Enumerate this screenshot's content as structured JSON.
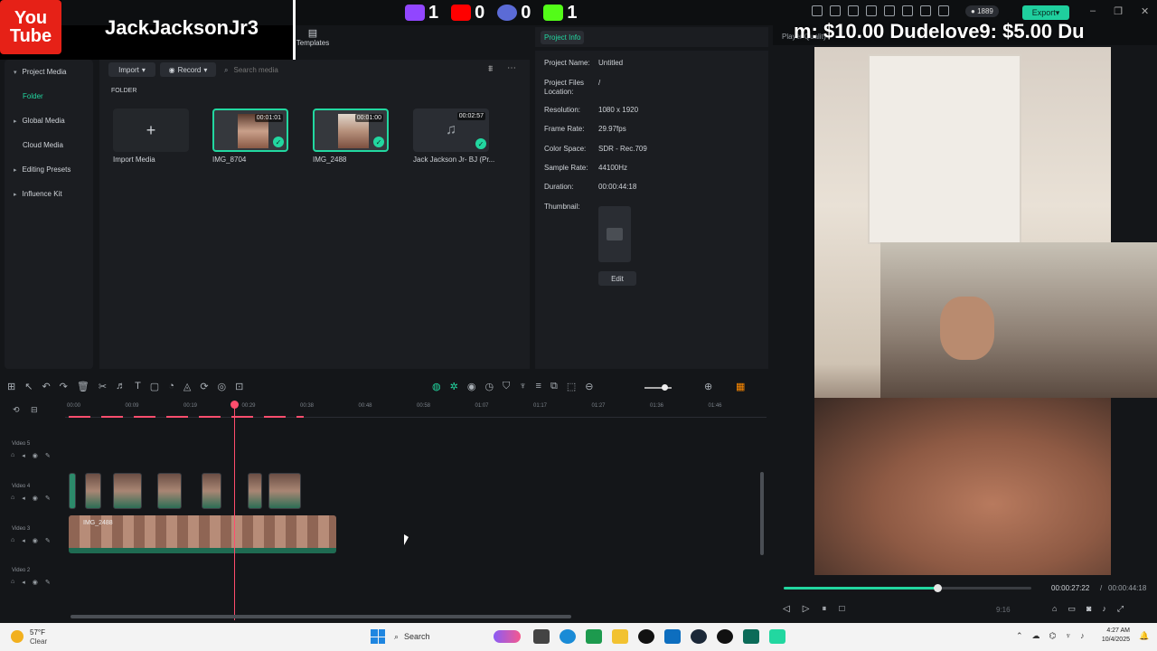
{
  "overlay": {
    "channel": "JackJacksonJr3",
    "yt_line1": "You",
    "yt_line2": "Tube",
    "stats": [
      {
        "name": "twitch",
        "value": "1",
        "color": "#9146ff"
      },
      {
        "name": "youtube",
        "value": "0",
        "color": "#ff0000"
      },
      {
        "name": "other",
        "value": "0",
        "color": "#5b6bd6"
      },
      {
        "name": "kick",
        "value": "1",
        "color": "#53fc18"
      }
    ],
    "donations": "m: $10.00   Dudelove9: $5.00   Du"
  },
  "topbar": {
    "credits": "1889",
    "export": "Export"
  },
  "templates": {
    "label": "Templates"
  },
  "sidebar": {
    "items": [
      {
        "label": "Project Media",
        "expand": "▾"
      },
      {
        "label": "Folder",
        "sub": true
      },
      {
        "label": "Global Media",
        "expand": "▸"
      },
      {
        "label": "Cloud Media"
      },
      {
        "label": "Editing Presets",
        "expand": "▸"
      },
      {
        "label": "Influence Kit",
        "expand": "▸"
      }
    ]
  },
  "media": {
    "import": "Import",
    "record": "Record",
    "search_placeholder": "Search media",
    "folder": "FOLDER",
    "tiles": [
      {
        "name": "Import Media",
        "duration": ""
      },
      {
        "name": "IMG_8704",
        "duration": "00:01:01"
      },
      {
        "name": "IMG_2488",
        "duration": "00:01:00"
      },
      {
        "name": "Jack Jackson Jr- BJ (Pr...",
        "duration": "00:02:57"
      }
    ]
  },
  "info": {
    "tab": "Project Info",
    "rows": [
      {
        "label": "Project Name:",
        "value": "Untitled"
      },
      {
        "label": "Project Files Location:",
        "value": "/"
      },
      {
        "label": "Resolution:",
        "value": "1080 x 1920"
      },
      {
        "label": "Frame Rate:",
        "value": "29.97fps"
      },
      {
        "label": "Color Space:",
        "value": "SDR - Rec.709"
      },
      {
        "label": "Sample Rate:",
        "value": "44100Hz"
      },
      {
        "label": "Duration:",
        "value": "00:00:44:18"
      },
      {
        "label": "Thumbnail:",
        "value": ""
      }
    ],
    "edit": "Edit"
  },
  "player": {
    "label": "Player   Quality",
    "current": "00:00:27:22",
    "sep": "/",
    "total": "00:00:44:18",
    "ratio": "9:16",
    "progress": 0.62
  },
  "timeline": {
    "ticks": [
      "00:00",
      "00:09",
      "00:19",
      "00:29",
      "00:38",
      "00:48",
      "00:58",
      "01:07",
      "01:17",
      "01:27",
      "01:36",
      "01:46"
    ],
    "tracks": [
      "Video 5",
      "Video 4",
      "Video 3",
      "Video 2"
    ],
    "main_clip": "IMG_2488"
  },
  "taskbar": {
    "temp": "57°F",
    "cond": "Clear",
    "search": "Search",
    "time": "4:27 AM",
    "date": "10/4/2025"
  }
}
